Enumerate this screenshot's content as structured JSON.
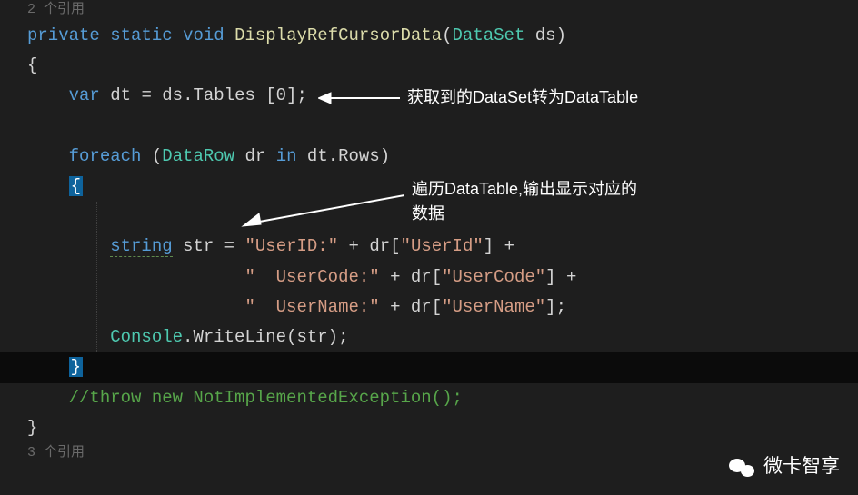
{
  "references": {
    "top": "2 个引用",
    "bottom": "3 个引用"
  },
  "code": {
    "kw_private": "private",
    "kw_static": "static",
    "kw_void": "void",
    "method_name": "DisplayRefCursorData",
    "param_type": "DataSet",
    "param_name": "ds",
    "open_brace": "{",
    "close_brace": "}",
    "kw_var": "var",
    "var_dt": "dt",
    "eq": " = ",
    "ds_tables": "ds.Tables [0];",
    "kw_foreach": "foreach",
    "datarow": "DataRow",
    "var_dr": "dr",
    "kw_in": "in",
    "dt_rows": "dt.Rows",
    "kw_string": "string",
    "var_str": "str",
    "str_userid": "\"UserID:\"",
    "plus": " + ",
    "dr_userid": "dr[\"UserId\"]",
    "str_usercode": "\"  UserCode:\"",
    "dr_usercode": "dr[\"UserCode\"]",
    "str_username": "\"  UserName:\"",
    "dr_username": "dr[\"UserName\"]",
    "semicolon": ";",
    "console": "Console",
    "writeline": ".WriteLine(str);",
    "comment": "//throw new NotImplementedException();"
  },
  "annotations": {
    "a1": "获取到的DataSet转为DataTable",
    "a2_line1": "遍历DataTable,输出显示对应的",
    "a2_line2": "数据"
  },
  "watermark": "微卡智享"
}
